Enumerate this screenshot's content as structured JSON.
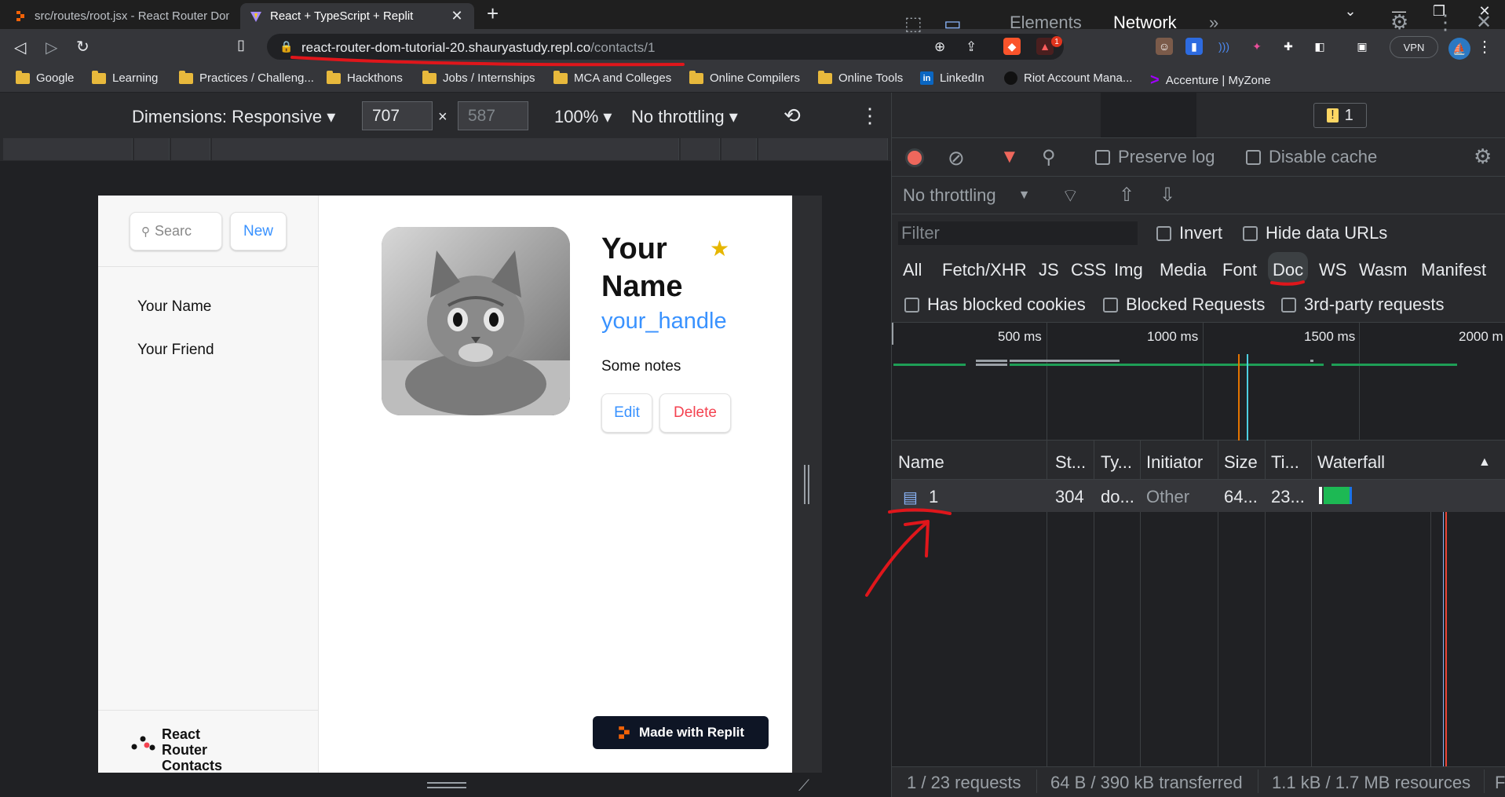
{
  "tabs": [
    {
      "title": "src/routes/root.jsx - React Router Dom"
    },
    {
      "title": "React + TypeScript + Replit"
    }
  ],
  "toolbar": {
    "url_host": "react-router-dom-tutorial-20.shauryastudy.repl.co",
    "url_path": "/contacts/1",
    "vpn": "VPN",
    "notif_count": "1"
  },
  "bookmarks": [
    "Google",
    "Learning",
    "Practices / Challeng...",
    "Hackthons",
    "Jobs / Internships",
    "MCA and Colleges",
    "Online Compilers",
    "Online Tools",
    "LinkedIn",
    "Riot Account Mana...",
    "Accenture | MyZone"
  ],
  "device_toolbar": {
    "dimensions": "Dimensions: Responsive",
    "width": "707",
    "height": "587",
    "zoom": "100%",
    "throttling": "No throttling",
    "times": "×"
  },
  "app": {
    "search_placeholder": "Searc",
    "new_label": "New",
    "contacts": [
      "Your Name",
      "Your Friend"
    ],
    "footer_label": "React Router Contacts",
    "name": "Your Name",
    "star": "★",
    "handle": "your_handle",
    "notes": "Some notes",
    "edit": "Edit",
    "delete": "Delete",
    "made_with": "Made with Replit"
  },
  "devtools": {
    "tabs": [
      "Elements",
      "Network"
    ],
    "more": "»",
    "issues_count": "1",
    "preserve_log": "Preserve log",
    "disable_cache": "Disable cache",
    "throttling": "No throttling",
    "filter_placeholder": "Filter",
    "invert": "Invert",
    "hide_data_urls": "Hide data URLs",
    "types": [
      "All",
      "Fetch/XHR",
      "JS",
      "CSS",
      "Img",
      "Media",
      "Font",
      "Doc",
      "WS",
      "Wasm",
      "Manifest"
    ],
    "has_blocked_cookies": "Has blocked cookies",
    "blocked_requests": "Blocked Requests",
    "third_party": "3rd-party requests",
    "timeline_ticks": [
      "500 ms",
      "1000 ms",
      "1500 ms",
      "2000 m"
    ],
    "columns": [
      "Name",
      "St...",
      "Ty...",
      "Initiator",
      "Size",
      "Ti...",
      "Waterfall"
    ],
    "row": {
      "name": "1",
      "status": "304",
      "type": "do...",
      "initiator": "Other",
      "size": "64...",
      "time": "23..."
    },
    "status_bar": [
      "1 / 23 requests",
      "64 B / 390 kB transferred",
      "1.1 kB / 1.7 MB resources",
      "F"
    ]
  }
}
